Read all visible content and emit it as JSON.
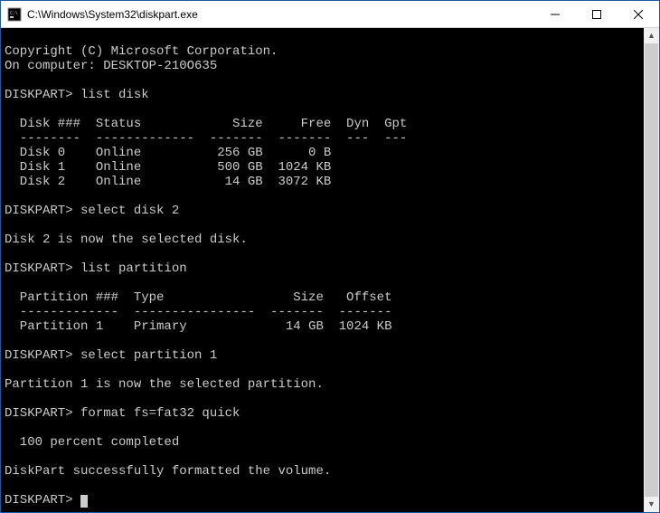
{
  "window": {
    "title": "C:\\Windows\\System32\\diskpart.exe"
  },
  "prompt": "DISKPART>",
  "intro": {
    "copyright": "Copyright (C) Microsoft Corporation.",
    "computer_line": "On computer: DESKTOP-210O635"
  },
  "cmd_list_disk": {
    "command": "list disk",
    "headers": {
      "disk": "Disk ###",
      "status": "Status",
      "size": "Size",
      "free": "Free",
      "dyn": "Dyn",
      "gpt": "Gpt"
    },
    "sep": {
      "disk": "--------",
      "status": "-------------",
      "size": "-------",
      "free": "-------",
      "dyn": "---",
      "gpt": "---"
    },
    "rows": [
      {
        "disk": "Disk 0",
        "status": "Online",
        "size": "256 GB",
        "free": "0 B",
        "dyn": "",
        "gpt": ""
      },
      {
        "disk": "Disk 1",
        "status": "Online",
        "size": "500 GB",
        "free": "1024 KB",
        "dyn": "",
        "gpt": ""
      },
      {
        "disk": "Disk 2",
        "status": "Online",
        "size": "14 GB",
        "free": "3072 KB",
        "dyn": "",
        "gpt": ""
      }
    ]
  },
  "cmd_select_disk": {
    "command": "select disk 2",
    "result": "Disk 2 is now the selected disk."
  },
  "cmd_list_part": {
    "command": "list partition",
    "headers": {
      "part": "Partition ###",
      "type": "Type",
      "size": "Size",
      "offset": "Offset"
    },
    "sep": {
      "part": "-------------",
      "type": "----------------",
      "size": "-------",
      "offset": "-------"
    },
    "rows": [
      {
        "part": "Partition 1",
        "type": "Primary",
        "size": "14 GB",
        "offset": "1024 KB"
      }
    ]
  },
  "cmd_select_part": {
    "command": "select partition 1",
    "result": "Partition 1 is now the selected partition."
  },
  "cmd_format": {
    "command": "format fs=fat32 quick",
    "progress": "100 percent completed",
    "result": "DiskPart successfully formatted the volume."
  }
}
